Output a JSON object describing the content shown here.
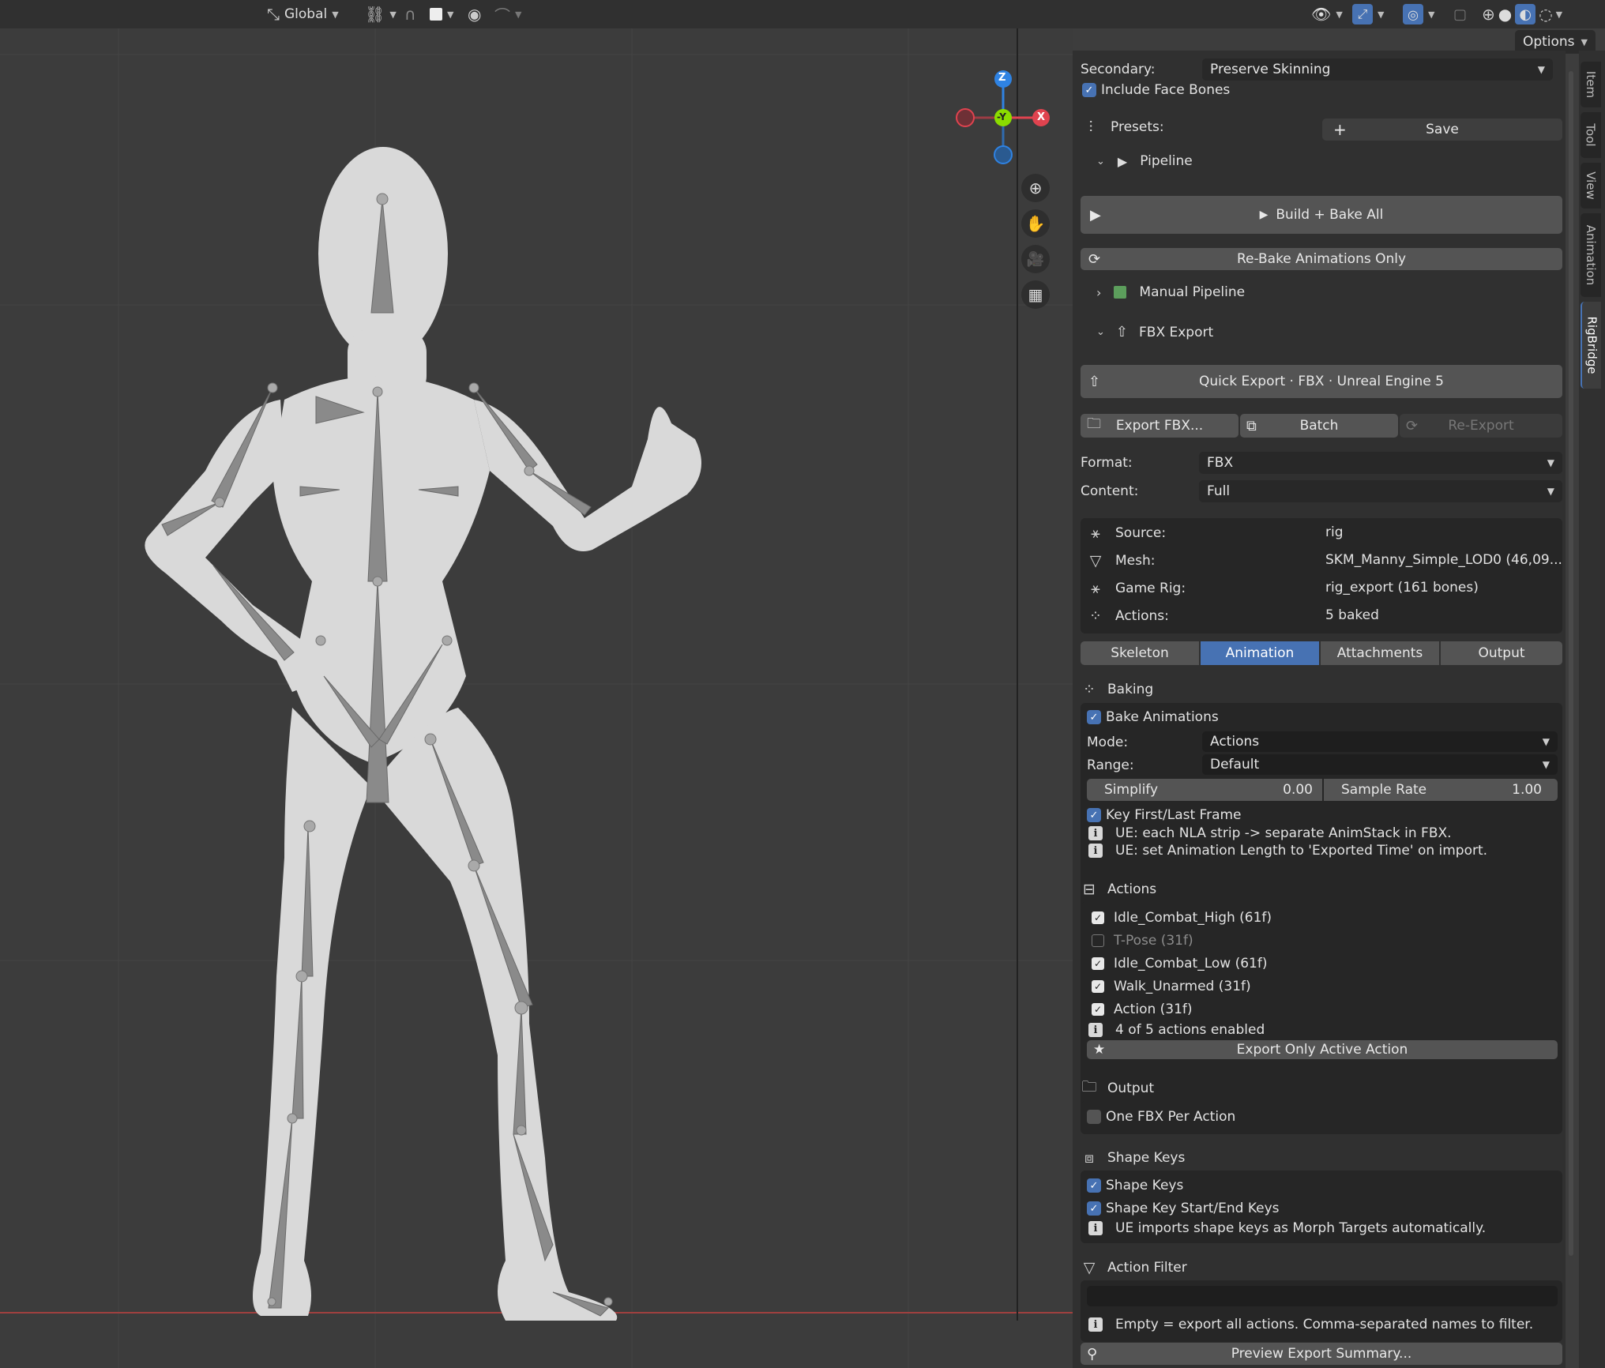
{
  "header": {
    "transform_orientation": "Global",
    "options_label": "Options"
  },
  "gizmo": {
    "z": "Z",
    "y": "-Y",
    "x": "X"
  },
  "viewport_icons": [
    "zoom-icon",
    "hand-pan-icon",
    "camera-icon",
    "grid-icon"
  ],
  "sidebar_tabs": [
    "Item",
    "Tool",
    "View",
    "Animation",
    "RigBridge"
  ],
  "panel": {
    "secondary_label": "Secondary:",
    "secondary_value": "Preserve Skinning",
    "include_face_bones": "Include Face Bones",
    "presets_label": "Presets:",
    "save_label": "Save",
    "pipeline": "Pipeline",
    "build_bake_all": "Build + Bake All",
    "rebake_only": "Re-Bake Animations Only",
    "manual_pipeline": "Manual Pipeline",
    "fbx_export": "FBX Export",
    "quick_export": "Quick Export · FBX · Unreal Engine 5",
    "export_fbx": "Export FBX...",
    "batch": "Batch",
    "re_export": "Re-Export",
    "format_label": "Format:",
    "format_value": "FBX",
    "content_label": "Content:",
    "content_value": "Full",
    "info": [
      {
        "label": "Source:",
        "value": "rig"
      },
      {
        "label": "Mesh:",
        "value": "SKM_Manny_Simple_LOD0  (46,09..."
      },
      {
        "label": "Game Rig:",
        "value": "rig_export  (161 bones)"
      },
      {
        "label": "Actions:",
        "value": "5 baked"
      }
    ],
    "tabs": [
      "Skeleton",
      "Animation",
      "Attachments",
      "Output"
    ],
    "active_tab": "Animation",
    "baking": {
      "header": "Baking",
      "bake_animations": "Bake Animations",
      "mode_label": "Mode:",
      "mode_value": "Actions",
      "range_label": "Range:",
      "range_value": "Default",
      "simplify_label": "Simplify",
      "simplify_value": "0.00",
      "sample_rate_label": "Sample Rate",
      "sample_rate_value": "1.00",
      "key_first_last": "Key First/Last Frame",
      "note1": "UE: each NLA strip -> separate AnimStack in FBX.",
      "note2": "UE: set Animation Length to 'Exported Time' on import."
    },
    "actions": {
      "header": "Actions",
      "items": [
        {
          "name": "Idle_Combat_High  (61f)",
          "enabled": true
        },
        {
          "name": "T-Pose  (31f)",
          "enabled": false
        },
        {
          "name": "Idle_Combat_Low  (61f)",
          "enabled": true
        },
        {
          "name": "Walk_Unarmed  (31f)",
          "enabled": true
        },
        {
          "name": "Action  (31f)",
          "enabled": true
        }
      ],
      "summary": "4 of 5 actions enabled",
      "export_active": "Export Only Active Action"
    },
    "output": {
      "header": "Output",
      "one_fbx_per_action": "One FBX Per Action"
    },
    "shape_keys": {
      "header": "Shape Keys",
      "shape_keys": "Shape Keys",
      "start_end_keys": "Shape Key Start/End Keys",
      "note": "UE imports shape keys as Morph Targets automatically."
    },
    "action_filter": {
      "header": "Action Filter",
      "value": "",
      "note": "Empty = export all actions. Comma-separated names to filter."
    },
    "preview_summary": "Preview Export Summary..."
  },
  "colors": {
    "accent": "#4772b3",
    "axis_x": "#e0434f",
    "axis_y": "#8bdc00",
    "axis_z": "#2f83e3",
    "manual_pipeline_swatch": "#5c9e5c"
  }
}
